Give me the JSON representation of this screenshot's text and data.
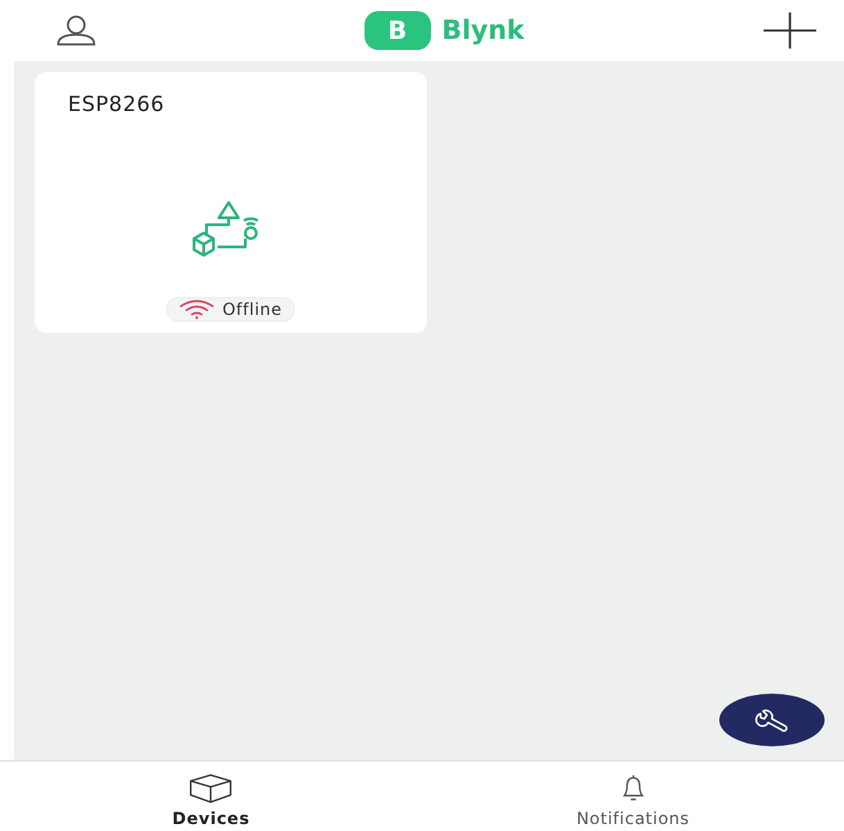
{
  "header": {
    "logo_letter": "B",
    "app_name": "Blynk"
  },
  "devices": [
    {
      "name": "ESP8266",
      "status": {
        "label": "Offline",
        "online": false
      }
    }
  ],
  "tabs": [
    {
      "label": "Devices",
      "selected": true
    },
    {
      "label": "Notifications",
      "selected": false
    }
  ]
}
